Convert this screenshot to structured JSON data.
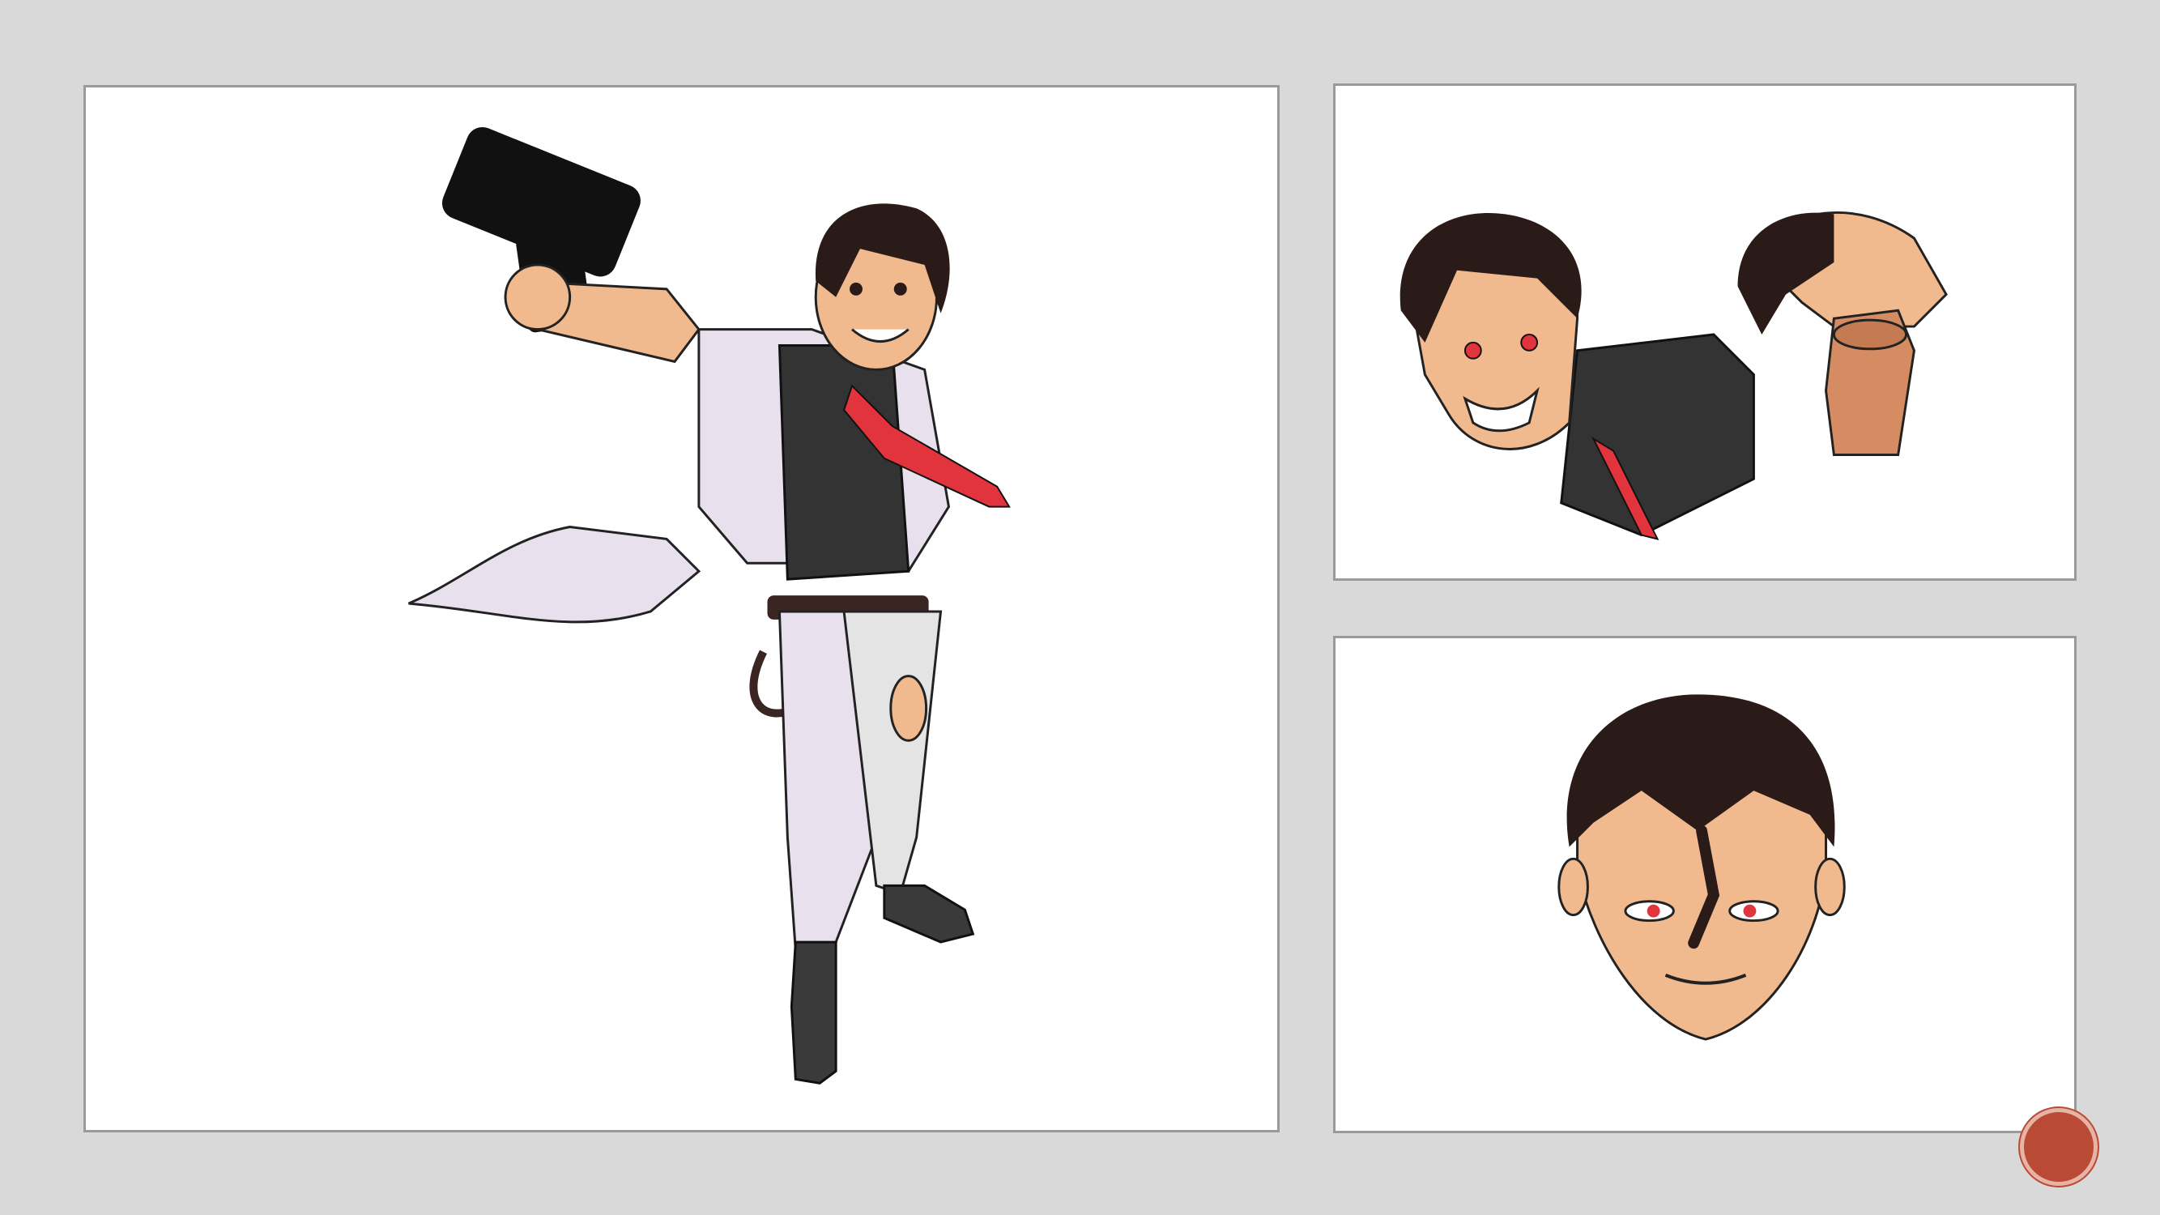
{
  "slide": {
    "badge_text": "",
    "panels": [
      {
        "id": "main",
        "subject": "full-body"
      },
      {
        "id": "heads",
        "subject": "head-studies"
      },
      {
        "id": "face",
        "subject": "face-close-up"
      }
    ]
  },
  "colors": {
    "background": "#d9d9d9",
    "panel_border": "#9a9a9a",
    "hair": "#2b1b18",
    "skin": "#f0b98e",
    "coat": "#e9e0ee",
    "shirt": "#333333",
    "tie": "#e2343d",
    "badge": "#b94a35"
  }
}
